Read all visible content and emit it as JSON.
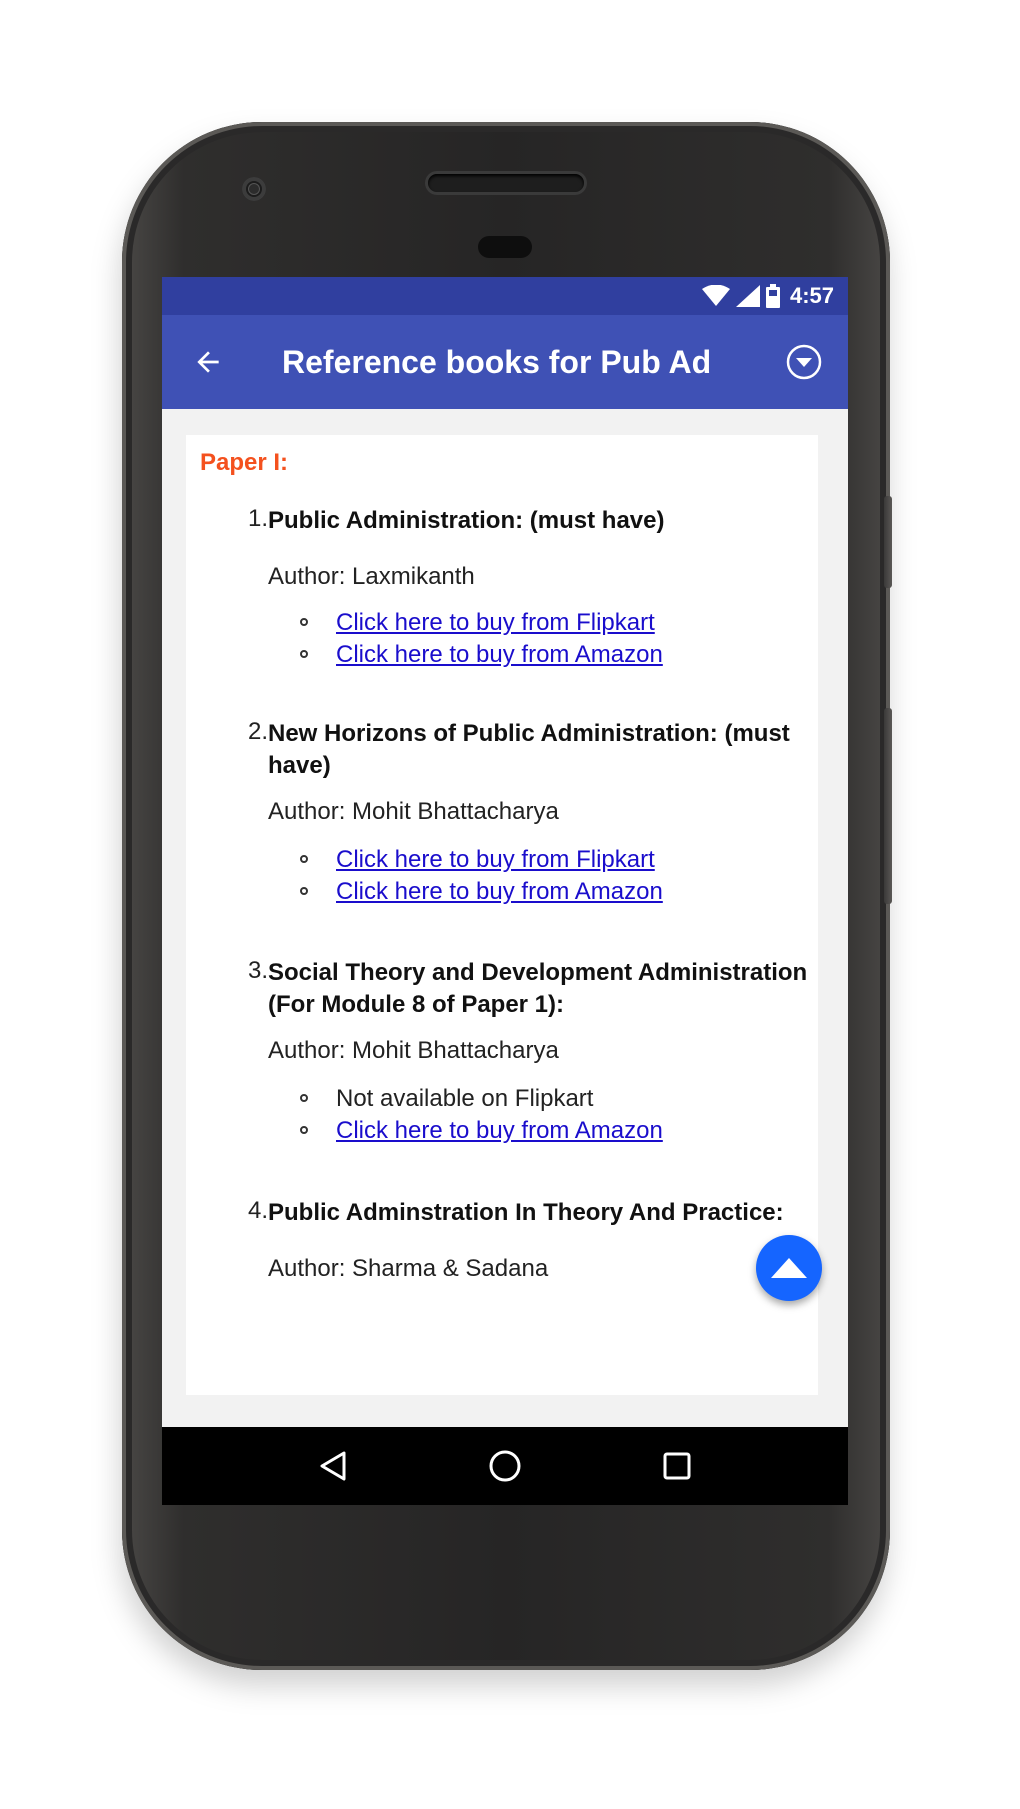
{
  "status_bar": {
    "time": "4:57"
  },
  "app_bar": {
    "title": "Reference books for Pub Ad",
    "back_icon": "arrow-back-icon",
    "menu_icon": "chevron-down-circle-icon"
  },
  "content": {
    "section_title": "Paper I:",
    "books": [
      {
        "number": "1.",
        "title": "Public Administration: (must have)",
        "author": "Author: Laxmikanth",
        "links": [
          {
            "label": "Click here to buy from Flipkart",
            "is_link": true
          },
          {
            "label": "Click here to buy from Amazon",
            "is_link": true
          }
        ]
      },
      {
        "number": "2.",
        "title": "New Horizons of Public Administration: (must have)",
        "author": "Author: Mohit Bhattacharya",
        "links": [
          {
            "label": "Click here to buy from Flipkart",
            "is_link": true
          },
          {
            "label": "Click here to buy from Amazon",
            "is_link": true
          }
        ]
      },
      {
        "number": "3.",
        "title": "Social Theory and Development Administration (For Module 8 of Paper 1):",
        "author": "Author: Mohit Bhattacharya",
        "links": [
          {
            "label": "Not available on Flipkart",
            "is_link": false
          },
          {
            "label": "Click here to buy from Amazon",
            "is_link": true
          }
        ]
      },
      {
        "number": "4.",
        "title": "Public Adminstration In Theory And Practice:",
        "author": "Author: Sharma & Sadana",
        "links": []
      }
    ]
  },
  "fab": {
    "icon": "scroll-to-top-icon"
  },
  "colors": {
    "status_bar": "#303f9f",
    "app_bar": "#3f51b5",
    "section_title": "#f4511e",
    "link": "#1a0dcc",
    "fab": "#1565ff"
  }
}
